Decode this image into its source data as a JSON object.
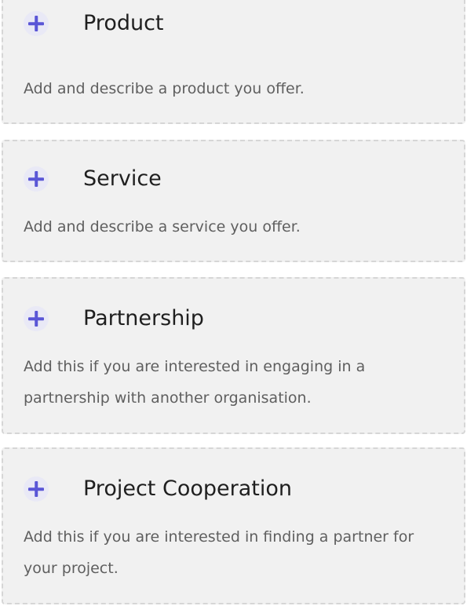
{
  "cards": [
    {
      "title": "Product",
      "description": "Add and describe a product you offer.",
      "icon": "plus-icon"
    },
    {
      "title": "Service",
      "description": "Add and describe a service you offer.",
      "icon": "plus-icon"
    },
    {
      "title": "Partnership",
      "description": "Add this if you are interested in engaging in a partnership with another organisation.",
      "icon": "plus-icon"
    },
    {
      "title": "Project Cooperation",
      "description": "Add this if you are interested in finding a partner for your project.",
      "icon": "plus-icon"
    }
  ],
  "colors": {
    "accent": "#5a56d6",
    "card_background": "#f1f1f1",
    "card_border": "#d6d6d6",
    "title": "#1f1f1f",
    "description": "#5f5f5f"
  }
}
